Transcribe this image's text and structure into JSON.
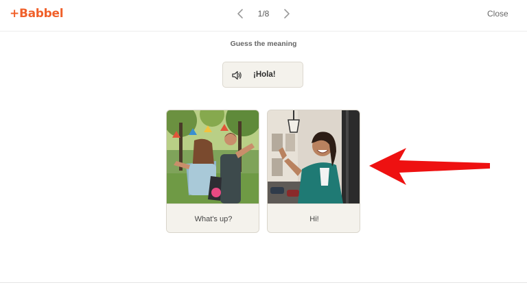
{
  "header": {
    "logo_text": "+Babbel",
    "counter": "1/8",
    "close_label": "Close"
  },
  "exercise": {
    "instruction": "Guess the meaning",
    "audio_word": "¡Hola!",
    "options": [
      {
        "label": "What's up?"
      },
      {
        "label": "Hi!"
      }
    ]
  },
  "colors": {
    "brand": "#f0602a",
    "card_background": "#f4f2ec",
    "annotation_arrow": "#ee1111"
  },
  "icons": [
    "chevron-left-icon",
    "chevron-right-icon",
    "speaker-icon",
    "red-arrow-annotation"
  ]
}
